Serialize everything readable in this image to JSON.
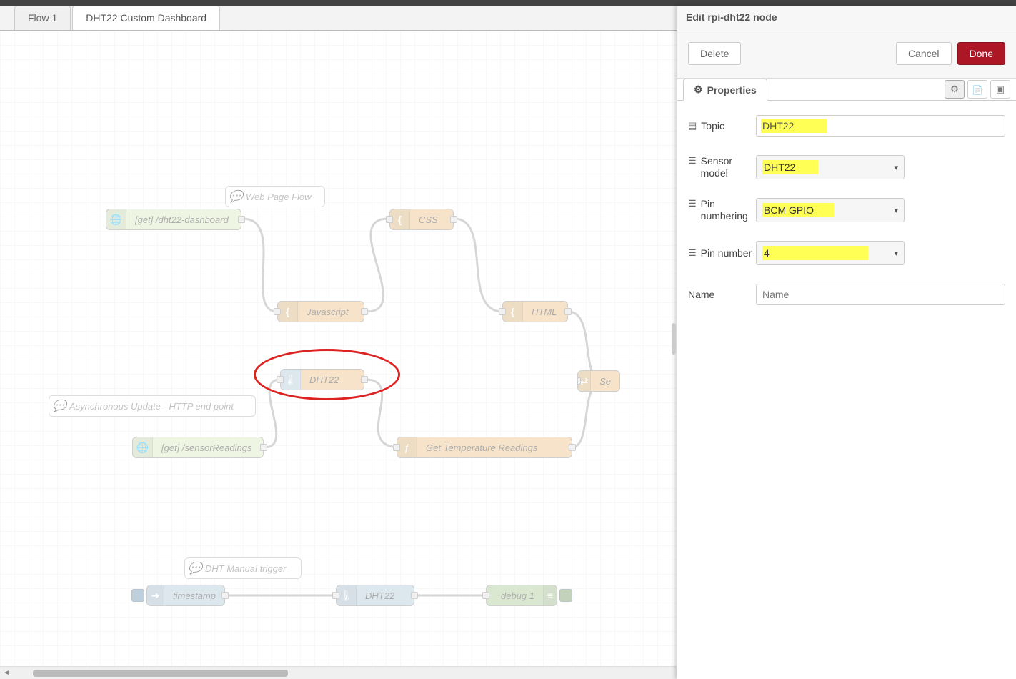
{
  "tabs": {
    "items": [
      {
        "label": "Flow 1"
      },
      {
        "label": "DHT22 Custom Dashboard"
      }
    ]
  },
  "comments": {
    "web_page_flow": "Web Page Flow",
    "async_update": "Asynchronous Update - HTTP end point",
    "manual_trigger": "DHT Manual trigger"
  },
  "nodes": {
    "httpin_dashboard": "[get] /dht22-dashboard",
    "css": "CSS",
    "javascript": "Javascript",
    "html": "HTML",
    "dht22_1": "DHT22",
    "set_partial": "Se",
    "httpin_sensor": "[get] /sensorReadings",
    "get_temp": "Get Temperature Readings",
    "timestamp": "timestamp",
    "dht22_2": "DHT22",
    "debug": "debug 1"
  },
  "panel": {
    "title": "Edit rpi-dht22 node",
    "delete": "Delete",
    "cancel": "Cancel",
    "done": "Done",
    "properties_tab": "Properties",
    "form": {
      "topic_label": "Topic",
      "topic_value": "DHT22",
      "sensor_label": "Sensor model",
      "sensor_value": "DHT22",
      "pin_numbering_label": "Pin numbering",
      "pin_numbering_value": "BCM GPIO",
      "pin_number_label": "Pin number",
      "pin_number_value": "4",
      "name_label": "Name",
      "name_placeholder": "Name"
    }
  }
}
